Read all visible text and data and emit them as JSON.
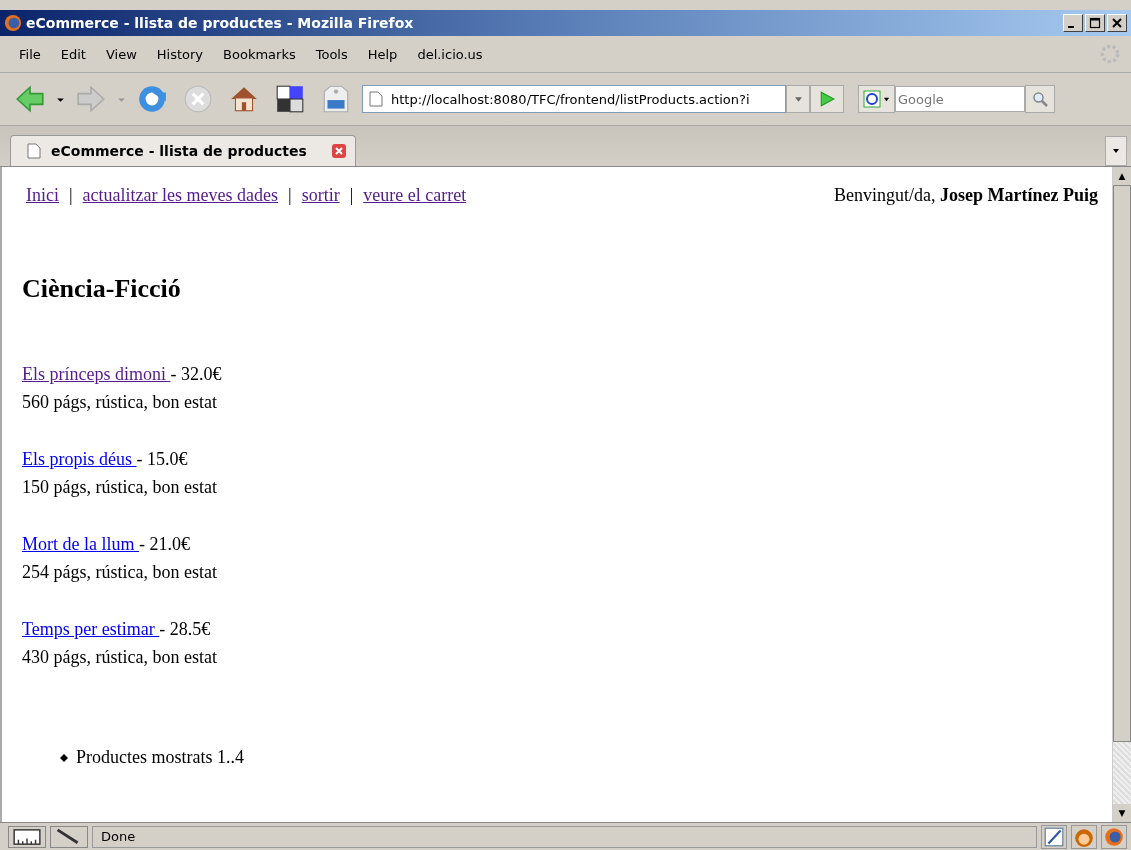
{
  "window": {
    "title": "eCommerce - llista de productes - Mozilla Firefox"
  },
  "menu": [
    "File",
    "Edit",
    "View",
    "History",
    "Bookmarks",
    "Tools",
    "Help",
    "del.icio.us"
  ],
  "address": {
    "value": "http://localhost:8080/TFC/frontend/listProducts.action?i"
  },
  "search": {
    "placeholder": "Google"
  },
  "tabs": [
    {
      "label": "eCommerce - llista de productes",
      "selected": true
    }
  ],
  "nav": [
    {
      "label": "Inici",
      "visited": true
    },
    {
      "label": "actualitzar les meves dades",
      "visited": true
    },
    {
      "label": "sortir",
      "visited": true
    },
    {
      "label": "veure el carret",
      "visited": true
    }
  ],
  "separator": "|",
  "greeting": {
    "text": "Benvingut/da, ",
    "name": "Josep Martínez Puig"
  },
  "heading": "Ciència-Ficció",
  "products": [
    {
      "title": "Els prínceps dimoni ",
      "price": " - 32.0€",
      "details": "560 págs, rústica, bon estat",
      "visited": true
    },
    {
      "title": "Els propis déus ",
      "price": " - 15.0€",
      "details": "150 págs, rústica, bon estat",
      "visited": false
    },
    {
      "title": "Mort de la llum ",
      "price": " - 21.0€",
      "details": "254 págs, rústica, bon estat",
      "visited": false
    },
    {
      "title": "Temps per estimar ",
      "price": " - 28.5€",
      "details": "430 págs, rústica, bon estat",
      "visited": false
    }
  ],
  "footer_items": [
    "Productes mostrats 1..4"
  ],
  "scrollbar": {
    "up": "▲",
    "down": "▼"
  },
  "status_bar": {
    "text": "Done"
  }
}
